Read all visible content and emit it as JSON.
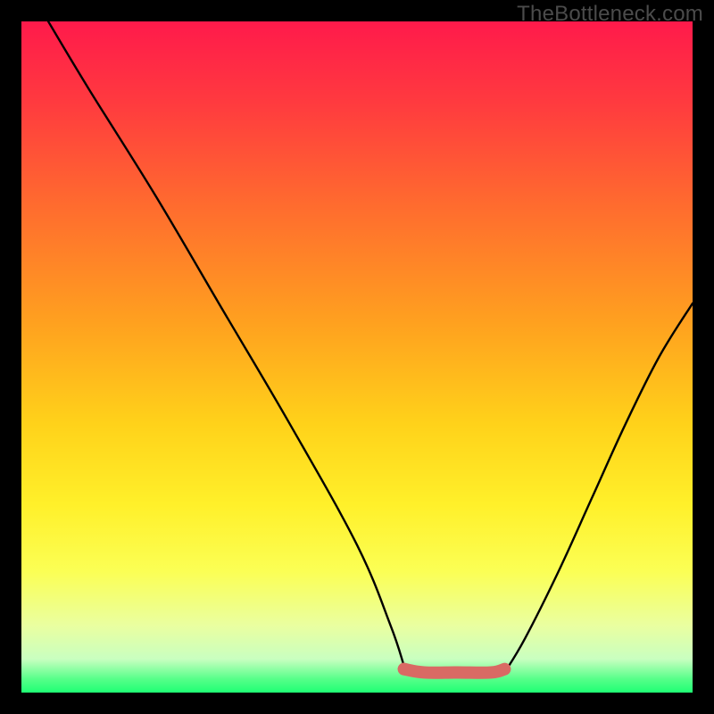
{
  "watermark": "TheBottleneck.com",
  "colors": {
    "frame": "#000000",
    "curve_stroke": "#000000",
    "marker": "#d96a64",
    "gradient_top": "#ff1a4b",
    "gradient_bottom": "#1fff74"
  },
  "chart_data": {
    "type": "line",
    "title": "",
    "xlabel": "",
    "ylabel": "",
    "xlim": [
      0,
      100
    ],
    "ylim": [
      0,
      100
    ],
    "series": [
      {
        "name": "left-curve",
        "x": [
          4,
          10,
          20,
          30,
          40,
          50,
          55,
          57
        ],
        "values": [
          100,
          90,
          74,
          57,
          40,
          22,
          10,
          4
        ]
      },
      {
        "name": "right-curve",
        "x": [
          72,
          75,
          80,
          85,
          90,
          95,
          100
        ],
        "values": [
          3,
          8,
          18,
          29,
          40,
          50,
          58
        ]
      },
      {
        "name": "marker-segment",
        "x": [
          57,
          60,
          65,
          70,
          72
        ],
        "values": [
          3.5,
          3,
          3,
          3,
          3.5
        ]
      }
    ],
    "annotations": []
  }
}
